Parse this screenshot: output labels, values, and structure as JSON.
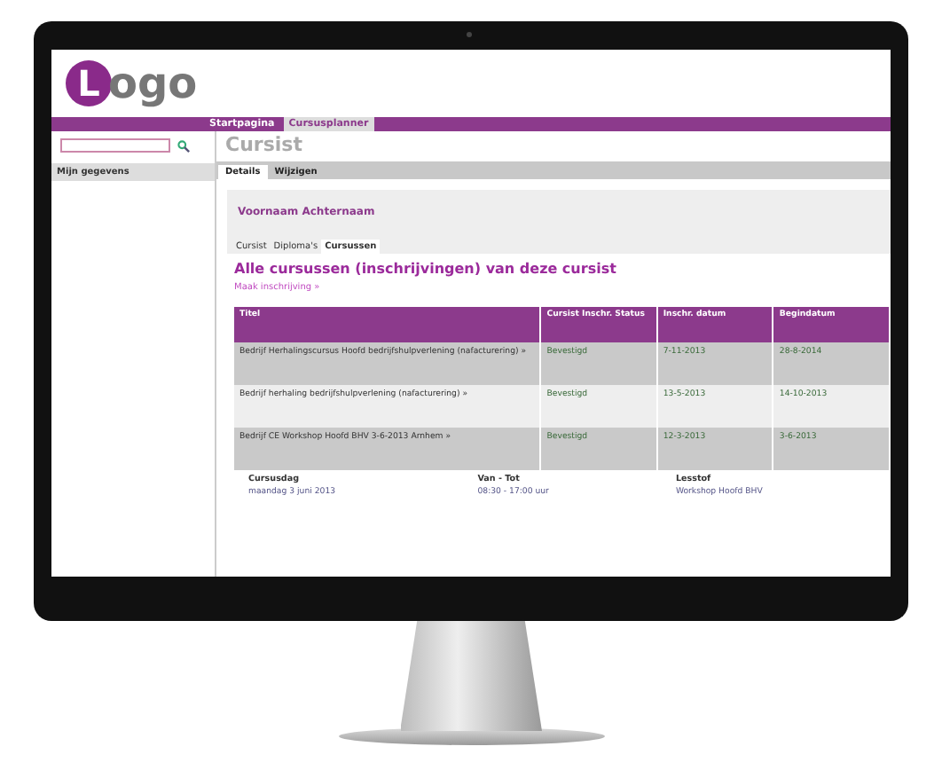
{
  "logo": {
    "initial": "L",
    "rest": "ogo"
  },
  "nav": [
    {
      "label": "Startpagina",
      "selected": false
    },
    {
      "label": "Cursusplanner",
      "selected": true
    }
  ],
  "sidebar": {
    "items": [
      {
        "label": "Mijn gegevens"
      }
    ]
  },
  "page_title": "Cursist",
  "tabs": [
    {
      "label": "Details",
      "selected": true
    },
    {
      "label": "Wijzigen",
      "selected": false
    }
  ],
  "person_name": "Voornaam Achternaam",
  "subtabs": [
    {
      "label": "Cursist",
      "selected": false
    },
    {
      "label": "Diploma's",
      "selected": false
    },
    {
      "label": "Cursussen",
      "selected": true
    }
  ],
  "heading": "Alle cursussen (inschrijvingen) van deze cursist",
  "link": "Maak inschrijving »",
  "table": {
    "columns": [
      "Titel",
      "Cursist Inschr. Status",
      "Inschr. datum",
      "Begindatum"
    ],
    "rows": [
      [
        "Bedrijf Herhalingscursus Hoofd bedrijfshulpverlening (nafacturering) »",
        "Bevestigd",
        "7-11-2013",
        "28-8-2014"
      ],
      [
        "Bedrijf herhaling bedrijfshulpverlening (nafacturering) »",
        "Bevestigd",
        "13-5-2013",
        "14-10-2013"
      ],
      [
        "Bedrijf CE Workshop Hoofd BHV 3-6-2013 Arnhem »",
        "Bevestigd",
        "12-3-2013",
        "3-6-2013"
      ]
    ]
  },
  "subtable": {
    "columns": [
      "Cursusdag",
      "Van - Tot",
      "Lesstof"
    ],
    "rows": [
      [
        "maandag 3 juni 2013",
        "08:30 - 17:00 uur",
        "Workshop Hoofd BHV"
      ]
    ]
  }
}
